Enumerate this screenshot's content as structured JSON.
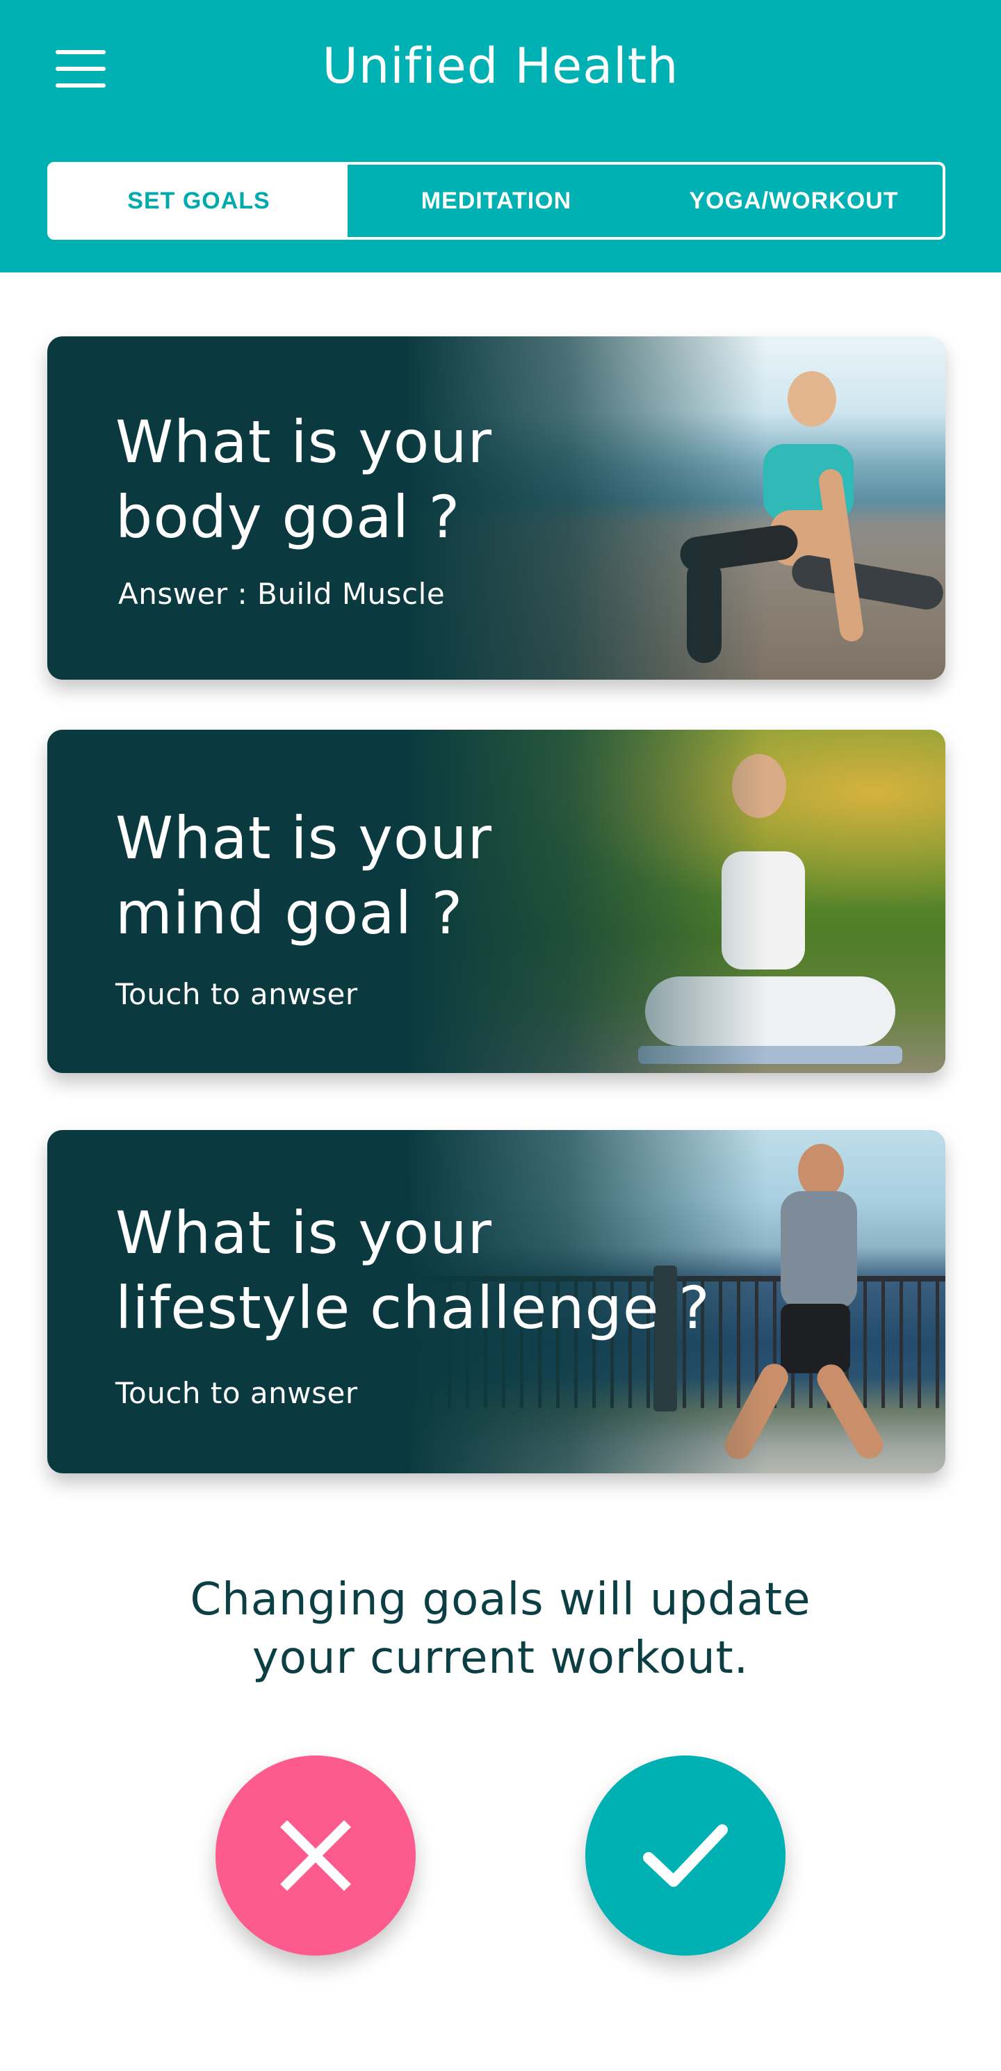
{
  "header": {
    "title": "Unified Health",
    "menu_icon": "hamburger-menu-icon",
    "background": "#00b1b3"
  },
  "tabs": [
    {
      "label": "SET GOALS",
      "active": true
    },
    {
      "label": "MEDITATION",
      "active": false
    },
    {
      "label": "YOGA/WORKOUT",
      "active": false
    }
  ],
  "cards": [
    {
      "question_line1": "What is your",
      "question_line2": "body goal ?",
      "answer": "Answer : Build Muscle",
      "image": "woman-yoga-stretch-by-sea"
    },
    {
      "question_line1": "What is your",
      "question_line2": "mind goal ?",
      "answer": "Touch to anwser",
      "image": "woman-meditating-on-boardwalk"
    },
    {
      "question_line1": "What is your",
      "question_line2": "lifestyle challenge ?",
      "answer": "Touch to anwser",
      "image": "man-running-by-waterfront"
    }
  ],
  "notice": {
    "line1": "Changing goals will update",
    "line2": "your current workout."
  },
  "actions": {
    "cancel": {
      "icon": "close-icon",
      "color": "#fd5b8e"
    },
    "confirm": {
      "icon": "checkmark-icon",
      "color": "#00b1b3"
    }
  },
  "colors": {
    "accent": "#00b1b3",
    "card_dark": "#0a3a3f",
    "danger": "#fd5b8e",
    "text_dark": "#0b3f44"
  }
}
